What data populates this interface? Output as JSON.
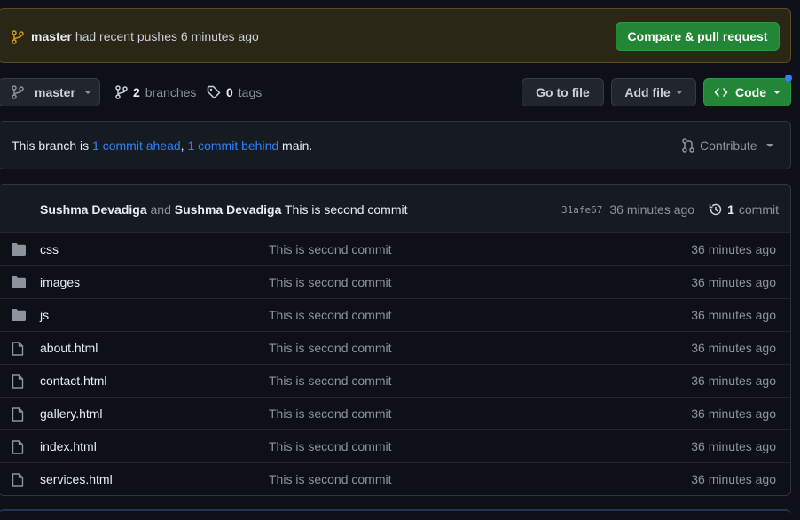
{
  "banner": {
    "branch": "master",
    "message": "had recent pushes 6 minutes ago",
    "compare_button": "Compare & pull request"
  },
  "toolbar": {
    "branch_select": "master",
    "branches_count": "2",
    "branches_label": "branches",
    "tags_count": "0",
    "tags_label": "tags",
    "go_to_file": "Go to file",
    "add_file": "Add file",
    "code": "Code"
  },
  "branch_status": {
    "prefix": "This branch is",
    "ahead": "1 commit ahead",
    "separator": ",",
    "behind": "1 commit behind",
    "suffix": "main.",
    "contribute": "Contribute"
  },
  "latest_commit": {
    "author1": "Sushma Devadiga",
    "and": "and",
    "author2": "Sushma Devadiga",
    "message": "This is second commit",
    "sha": "31afe67",
    "time": "36 minutes ago",
    "commit_count": "1",
    "commit_label": "commit"
  },
  "files": [
    {
      "type": "folder-icon",
      "name": "css",
      "message": "This is second commit",
      "age": "36 minutes ago"
    },
    {
      "type": "folder-icon",
      "name": "images",
      "message": "This is second commit",
      "age": "36 minutes ago"
    },
    {
      "type": "folder-icon",
      "name": "js",
      "message": "This is second commit",
      "age": "36 minutes ago"
    },
    {
      "type": "file-icon",
      "name": "about.html",
      "message": "This is second commit",
      "age": "36 minutes ago"
    },
    {
      "type": "file-icon",
      "name": "contact.html",
      "message": "This is second commit",
      "age": "36 minutes ago"
    },
    {
      "type": "file-icon",
      "name": "gallery.html",
      "message": "This is second commit",
      "age": "36 minutes ago"
    },
    {
      "type": "file-icon",
      "name": "index.html",
      "message": "This is second commit",
      "age": "36 minutes ago"
    },
    {
      "type": "file-icon",
      "name": "services.html",
      "message": "This is second commit",
      "age": "36 minutes ago"
    }
  ],
  "colors": {
    "accent_green": "#238636",
    "link_blue": "#2f81f7",
    "banner_bg": "#2b2717",
    "page_bg": "#0d1117"
  }
}
